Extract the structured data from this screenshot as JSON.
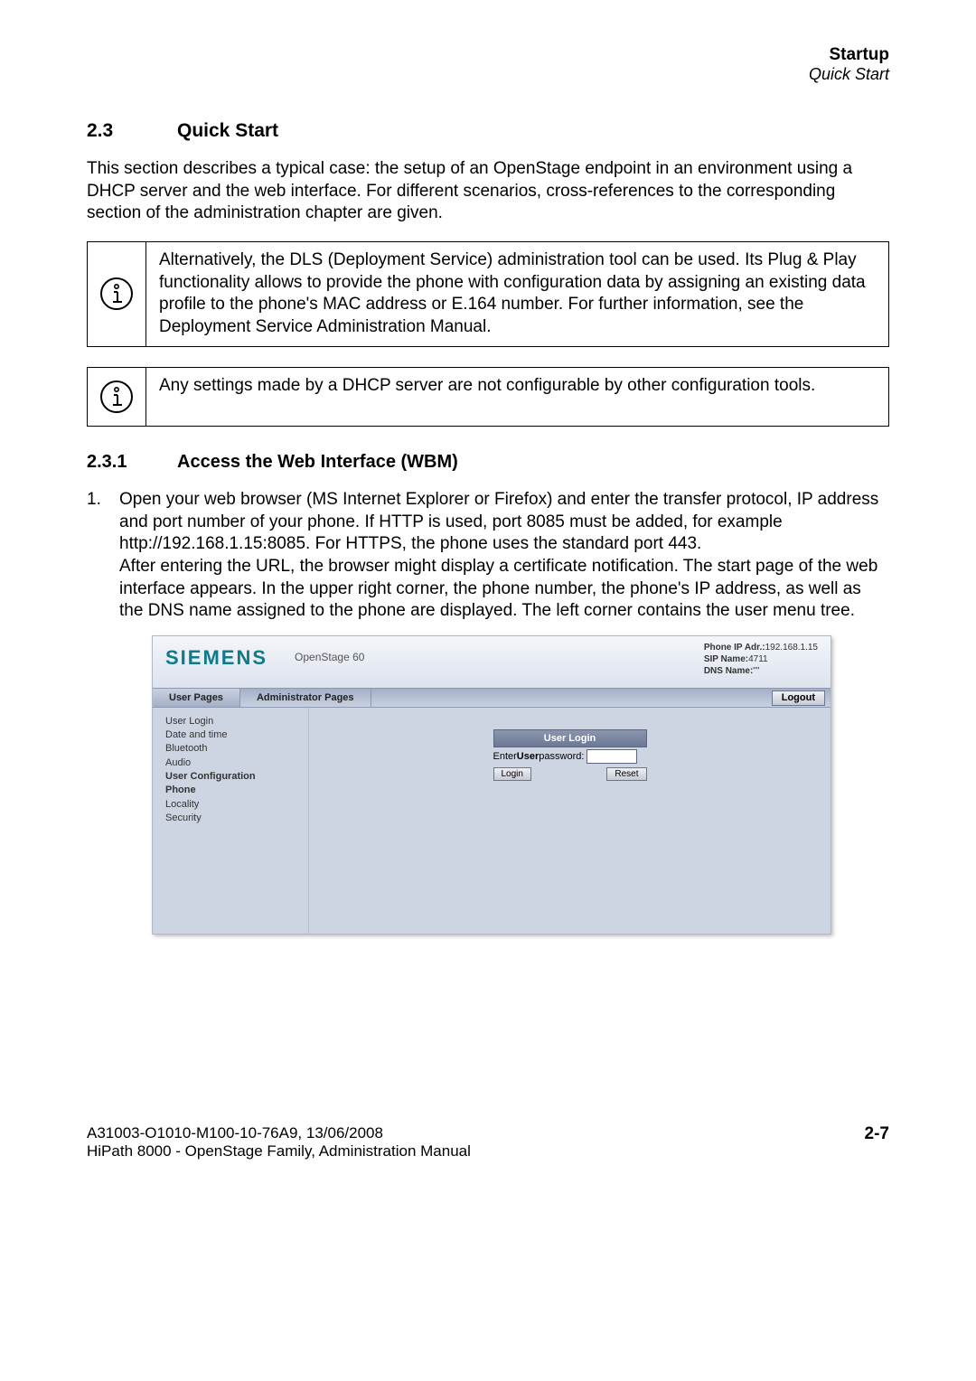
{
  "header": {
    "line1": "Startup",
    "line2": "Quick Start"
  },
  "section": {
    "num": "2.3",
    "title": "Quick Start",
    "intro": "This section describes a typical case: the setup of an OpenStage endpoint in an environment using a DHCP server and the web interface. For different scenarios, cross-references to the corresponding section of the administration chapter are given."
  },
  "notes": {
    "n1": "Alternatively, the DLS (Deployment Service) administration tool can be used. Its Plug & Play functionality allows to provide the phone with configuration data by assigning an existing data profile to the phone's MAC address or E.164 number. For further information, see the Deployment Service Administration Manual.",
    "n2": "Any settings made by a DHCP server are not configurable by other configuration tools."
  },
  "subsection": {
    "num": "2.3.1",
    "title": "Access the Web Interface (WBM)"
  },
  "step1": {
    "num": "1.",
    "p1": "Open your web browser (MS Internet Explorer or Firefox) and enter the transfer protocol, IP address and port number of your phone. If HTTP is used, port 8085 must be added, for example http://192.168.1.15:8085. For HTTPS, the phone uses the standard port 443.",
    "p2": "After entering the URL, the browser might display a certificate notification. The start page of the web interface appears. In the upper right corner, the phone number, the phone's IP address, as well as the DNS name assigned to the phone are displayed. The left corner contains the user menu tree."
  },
  "wbm": {
    "logo": "SIEMENS",
    "model": "OpenStage 60",
    "info": {
      "ip_label": "Phone IP Adr.:",
      "ip": "192.168.1.15",
      "sip_label": "SIP Name:",
      "sip": "4711",
      "dns_label": "DNS Name:",
      "dns": "\"\""
    },
    "tabs": {
      "user": "User Pages",
      "admin": "Administrator Pages",
      "logout": "Logout"
    },
    "menu": {
      "i0": "User Login",
      "i1": "Date and time",
      "i2": "Bluetooth",
      "i3": "Audio",
      "i4": "User Configuration",
      "i5": "Phone",
      "i6": "Locality",
      "i7": "Security"
    },
    "login": {
      "title": "User Login",
      "prompt_a": "Enter ",
      "prompt_b": "User",
      "prompt_c": " password:",
      "login_btn": "Login",
      "reset_btn": "Reset"
    }
  },
  "footer": {
    "line1": "A31003-O1010-M100-10-76A9, 13/06/2008",
    "line2": "HiPath 8000 - OpenStage Family, Administration Manual",
    "pagenum": "2-7"
  }
}
